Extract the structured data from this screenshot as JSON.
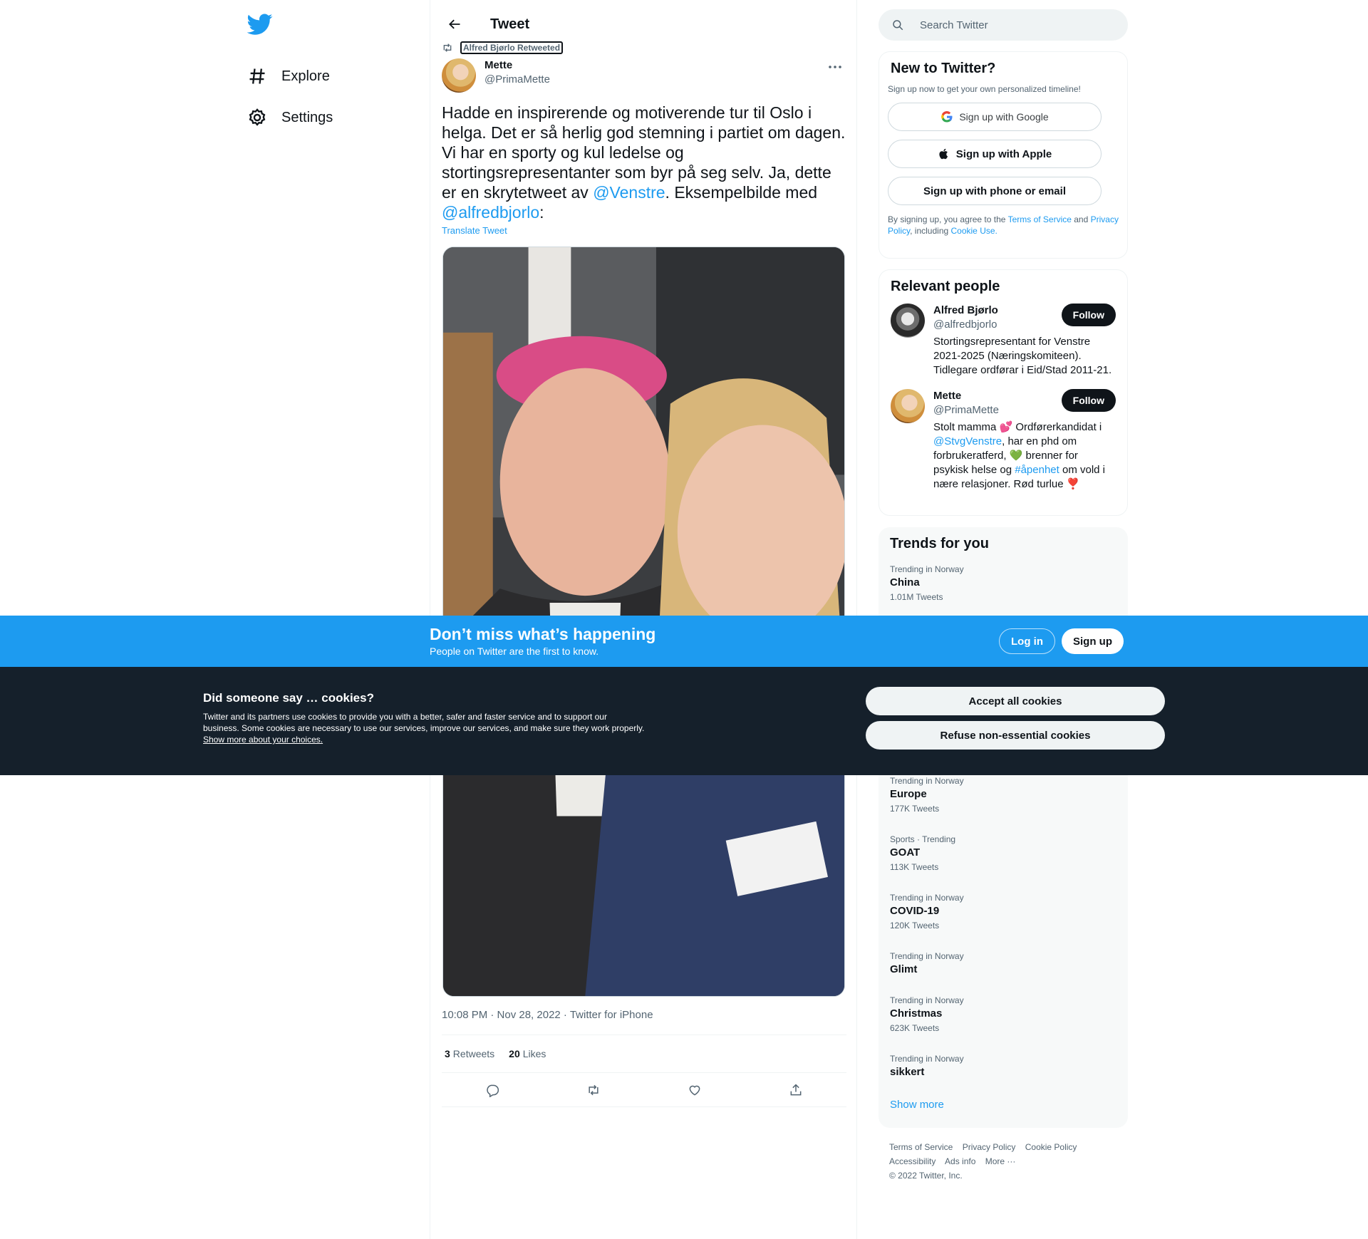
{
  "nav": {
    "explore": "Explore",
    "settings": "Settings"
  },
  "header": {
    "title": "Tweet"
  },
  "tweet": {
    "retweeted_by": "Alfred Bjørlo Retweeted",
    "author_name": "Mette",
    "author_handle": "@PrimaMette",
    "text_1": "Hadde en inspirerende og motiverende tur til Oslo i helga. Det er så herlig god stemning i partiet om dagen. Vi har en sporty og kul ledelse og stortingsrepresentanter som byr på seg selv. Ja, dette er en skrytetweet av ",
    "mention_1": "@Venstre",
    "text_2": ". Eksempelbilde med ",
    "mention_2": "@alfredbjorlo",
    "text_3": ":",
    "translate": "Translate Tweet",
    "timestamp": "10:08 PM · Nov 28, 2022 · Twitter for iPhone",
    "retweets_count": "3",
    "retweets_label": "Retweets",
    "likes_count": "20",
    "likes_label": "Likes"
  },
  "search": {
    "placeholder": "Search Twitter"
  },
  "signup_card": {
    "title": "New to Twitter?",
    "subtitle": "Sign up now to get your own personalized timeline!",
    "google": "Sign up with Google",
    "apple": "Sign up with Apple",
    "phone": "Sign up with phone or email",
    "terms_1": "By signing up, you agree to the ",
    "terms_link": "Terms of Service",
    "terms_2": " and ",
    "privacy_link": "Privacy Policy",
    "terms_3": ", including ",
    "cookie_link": "Cookie Use."
  },
  "people": {
    "title": "Relevant people",
    "follow": "Follow",
    "p1_name": "Alfred Bjørlo",
    "p1_handle": "@alfredbjorlo",
    "p1_bio": "Stortingsrepresentant for Venstre 2021-2025 (Næringskomiteen). Tidlegare ordførar i Eid/Stad 2011-21.",
    "p2_name": "Mette",
    "p2_handle": "@PrimaMette",
    "p2_bio_1": "Stolt mamma 💕 Ordførerkandidat i ",
    "p2_bio_link1": "@StvgVenstre",
    "p2_bio_2": ", har en phd om forbrukeratferd, 💚 brenner for psykisk helse og ",
    "p2_bio_link2": "#åpenhet",
    "p2_bio_3": " om vold i nære relasjoner. Rød turlue ❣️"
  },
  "trends": {
    "title": "Trends for you",
    "top": [
      {
        "context": "Trending in Norway",
        "topic": "China",
        "count": "1.01M Tweets"
      }
    ],
    "items": [
      {
        "context": "Trending in Norway",
        "topic": "Europe",
        "count": "177K Tweets"
      },
      {
        "context": "Sports · Trending",
        "topic": "GOAT",
        "count": "113K Tweets"
      },
      {
        "context": "Trending in Norway",
        "topic": "COVID-19",
        "count": "120K Tweets"
      },
      {
        "context": "Trending in Norway",
        "topic": "Glimt",
        "count": ""
      },
      {
        "context": "Trending in Norway",
        "topic": "Christmas",
        "count": "623K Tweets"
      },
      {
        "context": "Trending in Norway",
        "topic": "sikkert",
        "count": ""
      }
    ],
    "show_more": "Show more"
  },
  "footer": {
    "tos": "Terms of Service",
    "privacy": "Privacy Policy",
    "cookie": "Cookie Policy",
    "accessibility": "Accessibility",
    "ads": "Ads info",
    "more": "More ···",
    "copyright": "© 2022 Twitter, Inc."
  },
  "banner": {
    "title": "Don’t miss what’s happening",
    "subtitle": "People on Twitter are the first to know.",
    "login": "Log in",
    "signup": "Sign up"
  },
  "cookie_bar": {
    "title": "Did someone say … cookies?",
    "text": "Twitter and its partners use cookies to provide you with a better, safer and faster service and to support our business. Some cookies are necessary to use our services, improve our services, and make sure they work properly. ",
    "link": "Show more about your choices.",
    "accept": "Accept all cookies",
    "refuse": "Refuse non-essential cookies"
  },
  "colors": {
    "brand": "#1d9bf0",
    "cookie_bg": "#15202b",
    "text": "#0f1419",
    "muted": "#536471"
  },
  "icons": [
    "twitter-logo-icon",
    "hashtag-icon",
    "gear-icon",
    "back-arrow-icon",
    "retweet-icon",
    "more-icon",
    "search-icon",
    "google-icon",
    "apple-icon",
    "reply-icon",
    "like-icon",
    "share-icon"
  ]
}
